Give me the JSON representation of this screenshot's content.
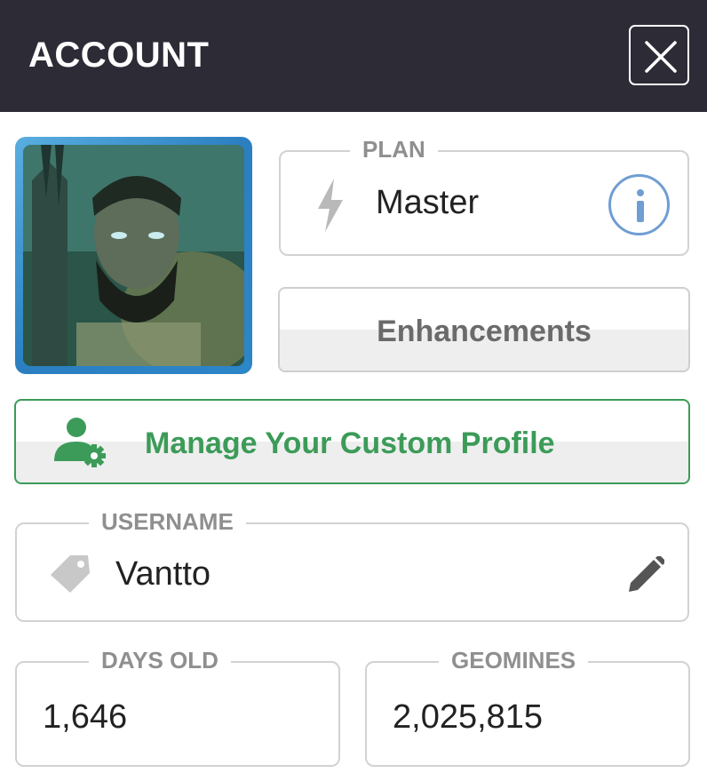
{
  "header": {
    "title": "ACCOUNT"
  },
  "plan": {
    "legend": "PLAN",
    "value": "Master"
  },
  "enhancements": {
    "label": "Enhancements"
  },
  "profile": {
    "label": "Manage Your Custom Profile"
  },
  "username": {
    "legend": "USERNAME",
    "value": "Vantto"
  },
  "days_old": {
    "legend": "DAYS OLD",
    "value": "1,646"
  },
  "geomines": {
    "legend": "GEOMINES",
    "value": "2,025,815"
  },
  "icons": {
    "close": "close-icon",
    "plan": "lightning-bolt-icon",
    "info": "info-icon",
    "profile": "user-gear-icon",
    "username": "tag-icon",
    "edit": "pencil-icon"
  },
  "colors": {
    "header_bg": "#2d2b36",
    "accent_blue": "#6f9ed3",
    "accent_green": "#3c9b58",
    "muted_text": "#8f8f8f",
    "border": "#d2d2d2"
  }
}
